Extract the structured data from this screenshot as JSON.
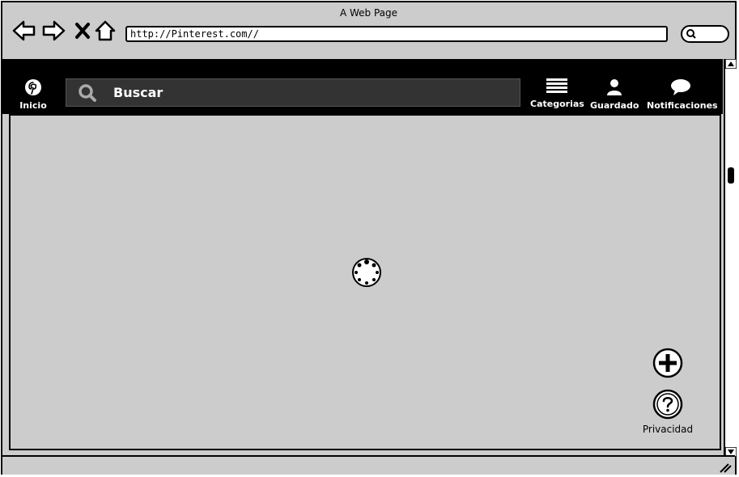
{
  "window": {
    "title": "A Web Page"
  },
  "browser": {
    "url": "http://Pinterest.com//"
  },
  "header": {
    "home_label": "Inicio",
    "search_placeholder": "Buscar",
    "categories_label": "Categorias",
    "saved_label": "Guardado",
    "notifications_label": "Notificaciones"
  },
  "floating": {
    "privacy_label": "Privacidad"
  },
  "icons": {
    "back": "arrow-left-icon",
    "forward": "arrow-right-icon",
    "stop": "close-icon",
    "home": "home-icon",
    "search": "search-icon",
    "pinterest": "pinterest-logo-icon",
    "categories": "menu-lines-icon",
    "saved": "user-icon",
    "notifications": "speech-bubble-icon",
    "loading": "loading-spinner-icon",
    "add": "plus-circle-icon",
    "help": "question-circle-icon"
  },
  "colors": {
    "header_bg": "#000000",
    "search_bg": "#333333",
    "page_bg": "#cccccc"
  }
}
